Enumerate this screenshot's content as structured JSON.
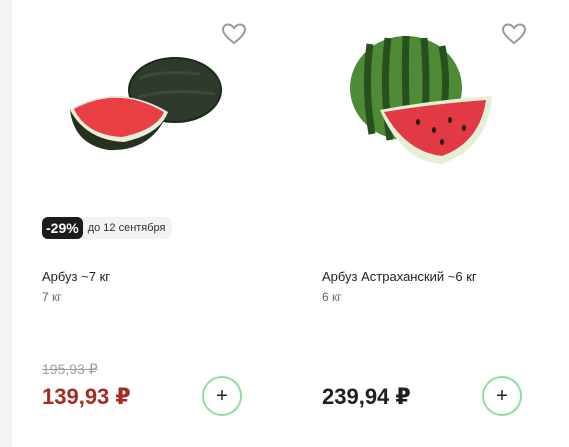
{
  "products": [
    {
      "name": "Арбуз ~7 кг",
      "weight": "7 кг",
      "discount_badge": "-29%",
      "promo_until": "до 12 сентября",
      "old_price": "195,93 ₽",
      "price": "139,93 ₽",
      "add_label": "+",
      "image": "watermelon-half-icon",
      "favorite_icon": "heart-outline-icon"
    },
    {
      "name": "Арбуз Астраханский ~6 кг",
      "weight": "6 кг",
      "price": "239,94 ₽",
      "add_label": "+",
      "image": "watermelon-whole-with-slice-icon",
      "favorite_icon": "heart-outline-icon"
    }
  ],
  "colors": {
    "sale_price": "#a52c22",
    "regular_price": "#1f1f1f",
    "badge_bg": "#1c1c1c",
    "add_button_border": "#8fdc9f"
  }
}
